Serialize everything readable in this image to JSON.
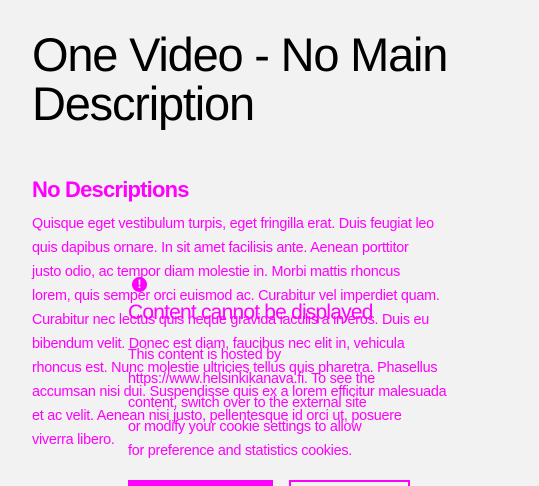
{
  "page": {
    "title": "One Video - No Main\nDescription",
    "section_title": "No Descriptions",
    "body_text": "Quisque eget vestibulum turpis, eget fringilla erat. Duis feugiat leo\nquis dapibus ornare. In sit amet facilisis ante. Aenean porttitor\njusto odio, ac tempor diam molestie in. Morbi mattis rhoncus\nlorem, quis semper orci euismod ac. Curabitur vel imperdiet quam.\nCurabitur nec lectus quis neque gravida iaculis a in eros. Duis eu\nbibendum velit. Donec est diam, faucibus nec elit in, vehicula\nrhoncus est. Nunc molestie ultricies tellus quis pharetra. Phasellus\naccumsan nisi dui. Suspendisse quis ex a lorem efficitur malesuada\net ac velit. Aenean nisi justo, pellentesque id orci ut, posuere\nviverra libero."
  },
  "embed": {
    "icon": "alert-icon",
    "icon_glyph": "!",
    "heading": "Content cannot be displayed",
    "text": "This content is hosted by\nhttps://www.helsinkikanava.fi. To see the\ncontent, switch over to the external site\nor modify your cookie settings to allow\nfor preference and statistics cookies.",
    "accent": "#ff00ff"
  },
  "colors": {
    "background": "#f2f2f2",
    "title": "#000000",
    "accent": "#ff00ff"
  }
}
